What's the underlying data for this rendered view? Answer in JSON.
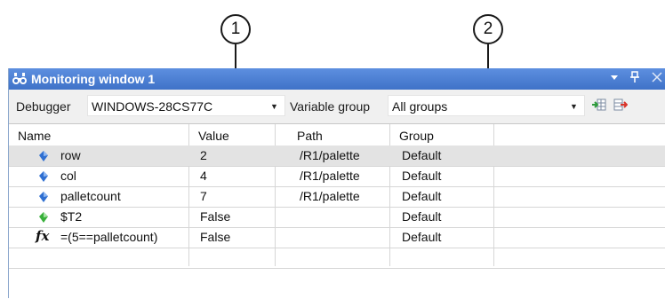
{
  "callouts": [
    "1",
    "2"
  ],
  "window": {
    "title": "Monitoring window 1",
    "buttons": [
      "▾",
      "ᵖ",
      "✕"
    ]
  },
  "toolbar": {
    "debugger_label": "Debugger",
    "debugger_value": "WINDOWS-28CS77C",
    "variable_group_label": "Variable group",
    "variable_group_value": "All groups"
  },
  "table": {
    "columns": [
      "Name",
      "Value",
      "Path",
      "Group"
    ],
    "rows": [
      {
        "icon": "blue-variable-icon",
        "name": "row",
        "value": "2",
        "path": "/R1/palette",
        "group": "Default",
        "selected": true
      },
      {
        "icon": "blue-variable-icon",
        "name": "col",
        "value": "4",
        "path": "/R1/palette",
        "group": "Default"
      },
      {
        "icon": "blue-variable-icon",
        "name": "palletcount",
        "value": "7",
        "path": "/R1/palette",
        "group": "Default"
      },
      {
        "icon": "green-variable-icon",
        "name": "$T2",
        "value": "False",
        "path": "",
        "group": "Default"
      },
      {
        "icon": "fx-expression-icon",
        "name": "=(5==palletcount)",
        "value": "False",
        "path": "",
        "group": "Default"
      }
    ]
  },
  "colors": {
    "titlebar": "#4a7fd6",
    "selection": "#e3e3e3",
    "blue_icon": "#2f6fd1",
    "green_icon": "#38b03a",
    "add_icon": "#2e9b3c",
    "remove_icon": "#d9342b"
  }
}
